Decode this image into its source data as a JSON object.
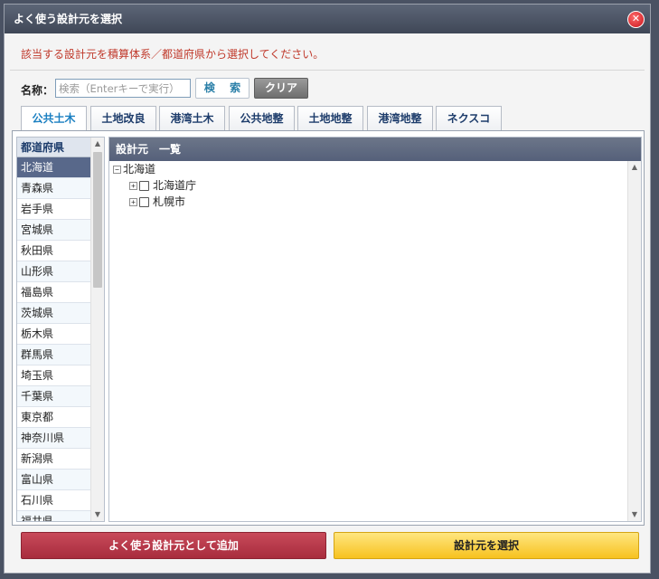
{
  "dialog": {
    "title": "よく使う設計元を選択",
    "close_icon": "close-icon",
    "notice": "該当する設計元を積算体系／都道府県から選択してください。"
  },
  "search": {
    "label": "名称：",
    "placeholder": "検索（Enterキーで実行）",
    "value": "",
    "search_button": "検 索",
    "clear_button": "クリア"
  },
  "tabs": [
    {
      "label": "公共土木",
      "active": true
    },
    {
      "label": "土地改良"
    },
    {
      "label": "港湾土木"
    },
    {
      "label": "公共地整"
    },
    {
      "label": "土地地整"
    },
    {
      "label": "港湾地整"
    },
    {
      "label": "ネクスコ"
    }
  ],
  "prefectures": {
    "header": "都道府県",
    "selected": "北海道",
    "items": [
      "北海道",
      "青森県",
      "岩手県",
      "宮城県",
      "秋田県",
      "山形県",
      "福島県",
      "茨城県",
      "栃木県",
      "群馬県",
      "埼玉県",
      "千葉県",
      "東京都",
      "神奈川県",
      "新潟県",
      "富山県",
      "石川県",
      "福井県"
    ]
  },
  "tree": {
    "header": "設計元　一覧",
    "root": {
      "label": "北海道",
      "expander": "−"
    },
    "children": [
      {
        "label": "北海道庁",
        "expander": "+",
        "checked": false
      },
      {
        "label": "札幌市",
        "expander": "+",
        "checked": false
      }
    ]
  },
  "actions": {
    "add_button": "よく使う設計元として追加",
    "select_button": "設計元を選択"
  },
  "colors": {
    "titlebar": "#4a5263",
    "notice": "#c0392b",
    "selected_row": "#58688a",
    "add_button": "#b83a4b",
    "select_button": "#f9cf3a"
  }
}
